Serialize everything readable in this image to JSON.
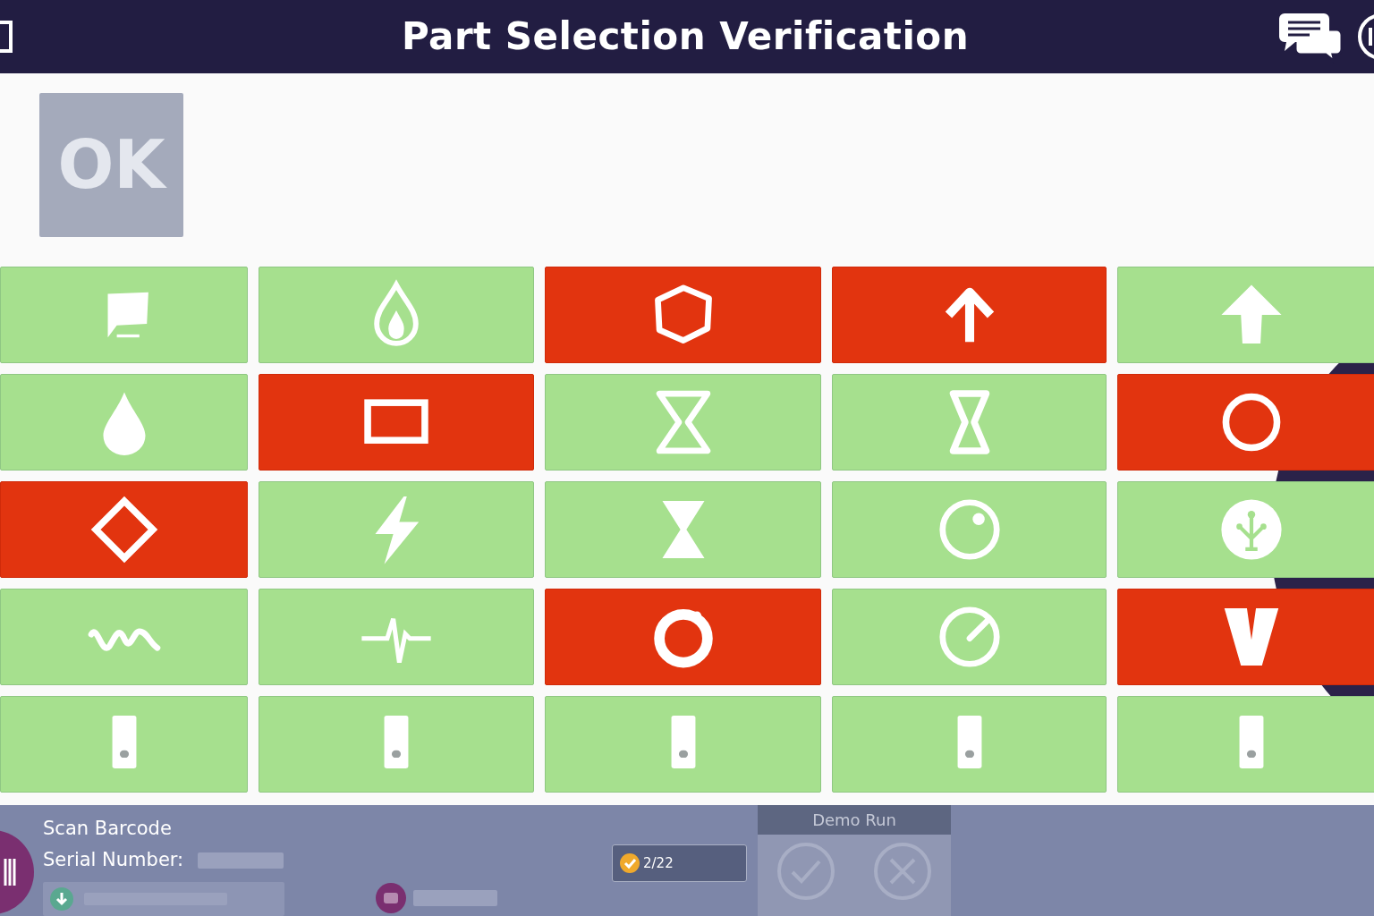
{
  "header": {
    "title": "Part Selection Verification"
  },
  "ok_button": {
    "label": "OK",
    "disabled": true
  },
  "parts": [
    {
      "kind": "flag",
      "error": false
    },
    {
      "kind": "flame",
      "error": false
    },
    {
      "kind": "hexagon",
      "error": true
    },
    {
      "kind": "arrow-outline",
      "error": true
    },
    {
      "kind": "arrow-solid",
      "error": false
    },
    {
      "kind": "drop",
      "error": false
    },
    {
      "kind": "rectangle",
      "error": true
    },
    {
      "kind": "hourglass-outline",
      "error": false
    },
    {
      "kind": "hourglass-narrow",
      "error": false
    },
    {
      "kind": "circle",
      "error": true
    },
    {
      "kind": "diamond",
      "error": true
    },
    {
      "kind": "bolt",
      "error": false
    },
    {
      "kind": "hourglass-solid",
      "error": false
    },
    {
      "kind": "ring-dot",
      "error": false
    },
    {
      "kind": "tree",
      "error": false
    },
    {
      "kind": "wave",
      "error": false
    },
    {
      "kind": "pulse",
      "error": false
    },
    {
      "kind": "ring-thick",
      "error": true
    },
    {
      "kind": "gauge",
      "error": false
    },
    {
      "kind": "v-shape",
      "error": true
    },
    {
      "kind": "device",
      "error": false
    },
    {
      "kind": "device",
      "error": false
    },
    {
      "kind": "device",
      "error": false
    },
    {
      "kind": "device",
      "error": false
    },
    {
      "kind": "device",
      "error": false
    }
  ],
  "footer": {
    "scan_label": "Scan Barcode",
    "serial_label": "Serial Number:",
    "progress": "2/22",
    "demo_panel": {
      "title": "Demo Run"
    }
  }
}
